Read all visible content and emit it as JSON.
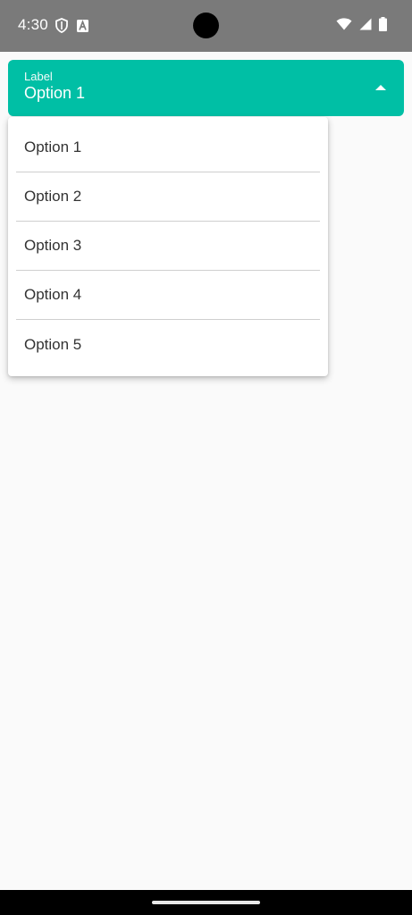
{
  "status_bar": {
    "time": "4:30",
    "left_icons": [
      "shield-icon",
      "a-letter-icon"
    ],
    "right_icons": [
      "wifi-icon",
      "cell-signal-icon",
      "battery-icon"
    ]
  },
  "dropdown": {
    "label": "Label",
    "value": "Option 1",
    "accent_color": "#00bfa5",
    "expanded": true
  },
  "menu": {
    "items": [
      "Option 1",
      "Option 2",
      "Option 3",
      "Option 4",
      "Option 5"
    ]
  }
}
